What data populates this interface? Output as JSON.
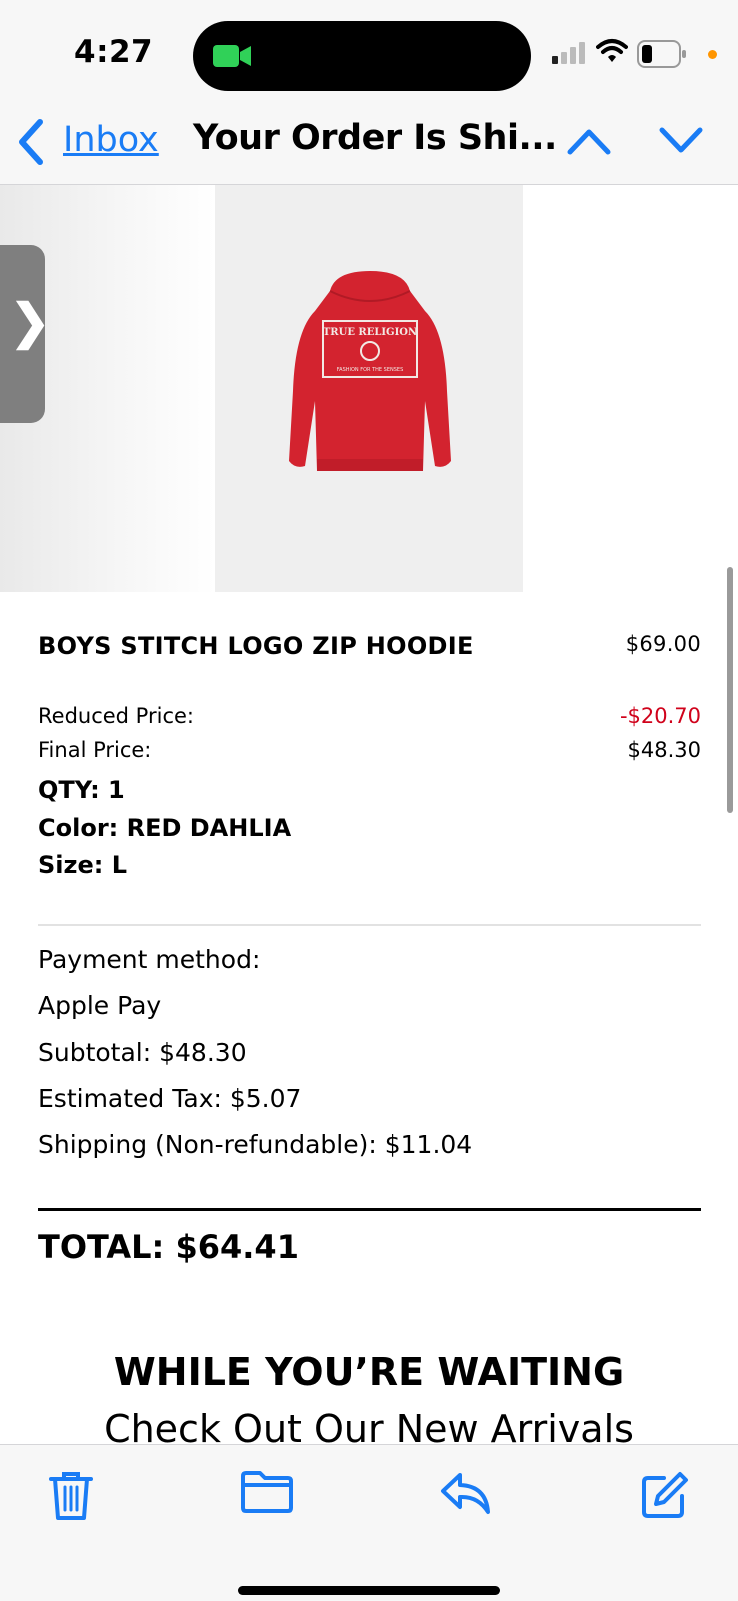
{
  "status_bar": {
    "time": "4:27"
  },
  "nav": {
    "back_label": "Inbox",
    "title": "Your Order Is Shi..."
  },
  "product": {
    "name": "BOYS STITCH LOGO ZIP HOODIE",
    "price": "$69.00",
    "reduced_label": "Reduced Price:",
    "reduced_value": "-$20.70",
    "final_label": "Final Price:",
    "final_value": "$48.30",
    "qty": "QTY: 1",
    "color": "Color: RED DAHLIA",
    "size": "Size: L",
    "image_text": "TRUE RELIGION"
  },
  "payment": {
    "method_label": "Payment method:",
    "method": "Apple Pay",
    "subtotal": "Subtotal: $48.30",
    "tax": "Estimated Tax: $5.07",
    "shipping": "Shipping (Non-refundable): $11.04",
    "total": "TOTAL: $64.41"
  },
  "promo": {
    "heading": "WHILE YOU’RE WAITING",
    "subheading": "Check Out Our New Arrivals"
  },
  "colors": {
    "accent": "#1a7cf5",
    "discount": "#d0021b",
    "hoodie": "#d3232f"
  },
  "icons": [
    "back-chevron-icon",
    "chevron-up-icon",
    "chevron-down-icon",
    "trash-icon",
    "folder-icon",
    "reply-icon",
    "compose-icon"
  ]
}
